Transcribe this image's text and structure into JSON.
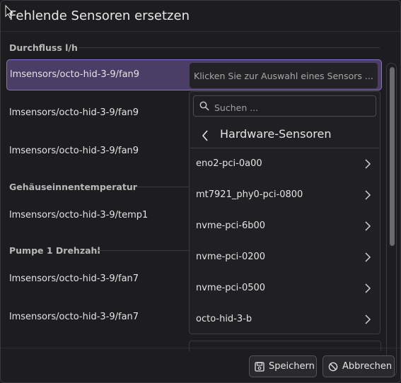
{
  "dialog": {
    "title": "Fehlende Sensoren ersetzen"
  },
  "sections": [
    {
      "header": "Durchfluss l/h"
    },
    {
      "header": "Gehäuseinnentemperatur"
    },
    {
      "header": "Pumpe 1 Drehzahl"
    }
  ],
  "rows": [
    {
      "label": "lmsensors/octo-hid-3-9/fan9"
    },
    {
      "label": "lmsensors/octo-hid-3-9/fan9"
    },
    {
      "label": "lmsensors/octo-hid-3-9/fan9"
    },
    {
      "label": "lmsensors/octo-hid-3-9/temp1"
    },
    {
      "label": "lmsensors/octo-hid-3-9/fan7"
    },
    {
      "label": "lmsensors/octo-hid-3-9/fan7"
    }
  ],
  "combo": {
    "placeholder": "Klicken Sie zur Auswahl eines Sensors ..."
  },
  "dropdown": {
    "search_placeholder": "Suchen ...",
    "title": "Hardware-Sensoren",
    "items": [
      {
        "label": "eno2-pci-0a00"
      },
      {
        "label": "mt7921_phy0-pci-0800"
      },
      {
        "label": "nvme-pci-6b00"
      },
      {
        "label": "nvme-pci-0200"
      },
      {
        "label": "nvme-pci-0500"
      },
      {
        "label": "octo-hid-3-b"
      }
    ]
  },
  "footer": {
    "save_label": "Speichern",
    "cancel_label": "Abbrechen"
  },
  "colors": {
    "selection": "#4a3d66",
    "selection_border": "#8a6fc4",
    "background": "#1d1d20"
  },
  "icons": [
    "cursor-icon",
    "search-icon",
    "chevron-left-icon",
    "chevron-right-icon",
    "save-icon",
    "cancel-icon"
  ]
}
